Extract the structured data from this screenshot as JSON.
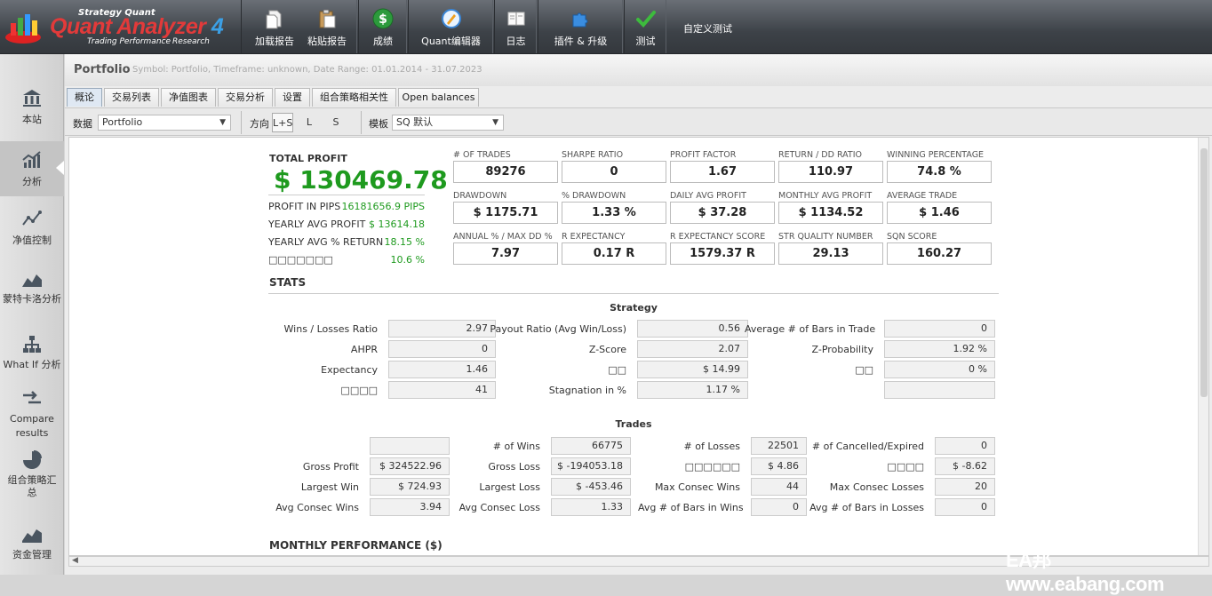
{
  "app": {
    "logo_top": "Strategy Quant",
    "logo_name": "Quant Analyzer",
    "logo_version": "4",
    "logo_tagline": "Trading Performance",
    "logo_research": "Research"
  },
  "toolbar": {
    "load_report": "加载报告",
    "paste_report": "粘贴报告",
    "results": "成绩",
    "quant_editor": "Quant编辑器",
    "log": "日志",
    "plugins": "插件 & 升级",
    "test": "测试",
    "custom_test": "自定义测试"
  },
  "sidebar": {
    "items": [
      "本站",
      "分析",
      "净值控制",
      "蒙特卡洛分析",
      "What If 分析",
      "Compare results",
      "组合策略汇总",
      "资金管理"
    ]
  },
  "header": {
    "title": "Portfolio",
    "subtitle": "Symbol: Portfolio, Timeframe: unknown, Date Range: 01.01.2014 - 31.07.2023"
  },
  "tabs": [
    "概论",
    "交易列表",
    "净值图表",
    "交易分析",
    "设置",
    "组合策略相关性",
    "Open balances"
  ],
  "filters": {
    "data_label": "数据",
    "data_value": "Portfolio",
    "direction_label": "方向",
    "dir_ls": "L+S",
    "dir_l": "L",
    "dir_s": "S",
    "template_label": "模板",
    "template_value": "SQ 默认"
  },
  "summary": {
    "total_profit_label": "TOTAL PROFIT",
    "total_profit": "$ 130469.78",
    "rows": [
      {
        "label": "PROFIT IN PIPS",
        "value": "16181656.9 PIPS"
      },
      {
        "label": "YEARLY AVG PROFIT",
        "value": "$ 13614.18"
      },
      {
        "label": "YEARLY AVG % RETURN",
        "value": "18.15 %"
      },
      {
        "label": "□□□□□□□",
        "value": "10.6 %"
      }
    ]
  },
  "kpis": [
    {
      "label": "# OF TRADES",
      "value": "89276"
    },
    {
      "label": "SHARPE RATIO",
      "value": "0"
    },
    {
      "label": "PROFIT FACTOR",
      "value": "1.67"
    },
    {
      "label": "RETURN / DD RATIO",
      "value": "110.97"
    },
    {
      "label": "WINNING PERCENTAGE",
      "value": "74.8 %"
    },
    {
      "label": "DRAWDOWN",
      "value": "$ 1175.71"
    },
    {
      "label": "% DRAWDOWN",
      "value": "1.33 %"
    },
    {
      "label": "DAILY AVG PROFIT",
      "value": "$ 37.28"
    },
    {
      "label": "MONTHLY AVG PROFIT",
      "value": "$ 1134.52"
    },
    {
      "label": "AVERAGE TRADE",
      "value": "$ 1.46"
    },
    {
      "label": "ANNUAL % / MAX DD %",
      "value": "7.97"
    },
    {
      "label": "R EXPECTANCY",
      "value": "0.17 R"
    },
    {
      "label": "R EXPECTANCY SCORE",
      "value": "1579.37 R"
    },
    {
      "label": "STR QUALITY NUMBER",
      "value": "29.13"
    },
    {
      "label": "SQN SCORE",
      "value": "160.27"
    }
  ],
  "stats_title": "STATS",
  "strategy": {
    "title": "Strategy",
    "cells": [
      {
        "label": "Wins / Losses Ratio",
        "value": "2.97"
      },
      {
        "label": "Payout Ratio (Avg Win/Loss)",
        "value": "0.56"
      },
      {
        "label": "Average # of Bars in Trade",
        "value": "0"
      },
      {
        "label": "AHPR",
        "value": "0"
      },
      {
        "label": "Z-Score",
        "value": "2.07"
      },
      {
        "label": "Z-Probability",
        "value": "1.92 %"
      },
      {
        "label": "Expectancy",
        "value": "1.46"
      },
      {
        "label": "□□",
        "value": "$ 14.99"
      },
      {
        "label": "□□",
        "value": "0 %"
      },
      {
        "label": "□□□□",
        "value": "41"
      },
      {
        "label": "Stagnation in %",
        "value": "1.17 %"
      },
      {
        "label": "",
        "value": ""
      }
    ]
  },
  "trades": {
    "title": "Trades",
    "cells": [
      {
        "label": "",
        "value": ""
      },
      {
        "label": "# of Wins",
        "value": "66775"
      },
      {
        "label": "# of Losses",
        "value": "22501"
      },
      {
        "label": "# of Cancelled/Expired",
        "value": "0"
      },
      {
        "label": "Gross Profit",
        "value": "$ 324522.96"
      },
      {
        "label": "Gross Loss",
        "value": "$ -194053.18"
      },
      {
        "label": "□□□□□□",
        "value": "$ 4.86"
      },
      {
        "label": "□□□□",
        "value": "$ -8.62"
      },
      {
        "label": "Largest Win",
        "value": "$ 724.93"
      },
      {
        "label": "Largest Loss",
        "value": "$ -453.46"
      },
      {
        "label": "Max Consec Wins",
        "value": "44"
      },
      {
        "label": "Max Consec Losses",
        "value": "20"
      },
      {
        "label": "Avg Consec Wins",
        "value": "3.94"
      },
      {
        "label": "Avg Consec Loss",
        "value": "1.33"
      },
      {
        "label": "Avg # of Bars in Wins",
        "value": "0"
      },
      {
        "label": "Avg # of Bars in Losses",
        "value": "0"
      }
    ]
  },
  "monthly_title": "MONTHLY PERFORMANCE ($)",
  "watermark": "EA邦 www.eabang.com",
  "colors": {
    "profit_green": "#1e9a1e",
    "toolbar_dark": "#3d4248",
    "logo_red": "#e23a3a",
    "logo_blue": "#3ba0e6"
  }
}
